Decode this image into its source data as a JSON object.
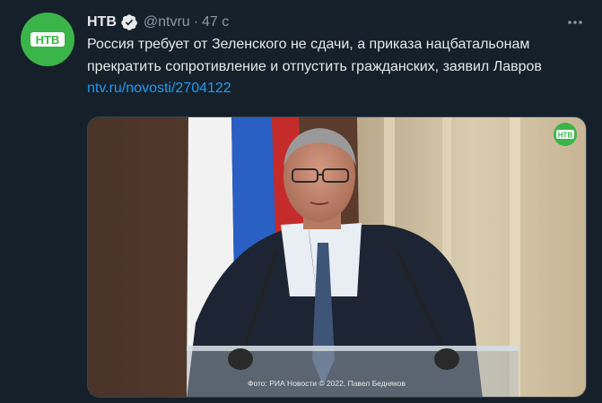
{
  "tweet": {
    "account_name": "НТВ",
    "handle": "@ntvru",
    "separator": "·",
    "time": "47 с",
    "text": "Россия требует от Зеленского не сдачи, а приказа нацбатальонам прекратить сопротивление и отпустить гражданских, заявил Лавров",
    "link_text": "ntv.ru/novosti/2704122",
    "photo_credit": "Фото: РИА Новости © 2022, Павел Бедняков",
    "logo_text": "НТВ"
  },
  "icons": {
    "avatar": "ntv-logo-icon",
    "verified": "verified-badge-icon",
    "more": "more-options-icon",
    "watermark": "ntv-watermark-icon"
  },
  "colors": {
    "background": "#15202b",
    "text": "#e7e9ea",
    "muted": "#8b98a5",
    "link": "#1d9bf0",
    "brand_green": "#3bb54a"
  }
}
